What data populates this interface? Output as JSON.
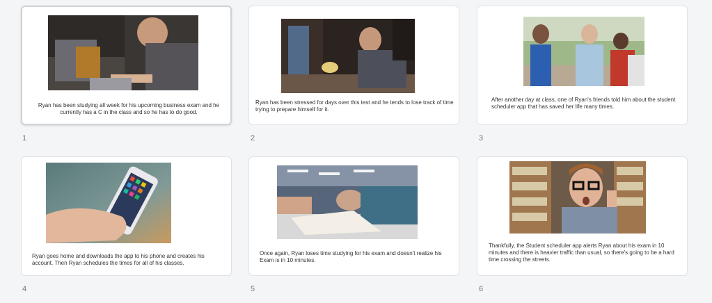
{
  "frames": [
    {
      "number": "1",
      "caption": "Ryan has been studying all week for his upcoming business exam and he currently has a C in the class and so he has to do good."
    },
    {
      "number": "2",
      "caption": "Ryan has been stressed for days over this test and he tends to lose track of time trying to prepare himself for it."
    },
    {
      "number": "3",
      "caption": "After another day at class, one of Ryan's friends told him about the student scheduler app that has saved her life many times."
    },
    {
      "number": "4",
      "caption": "Ryan goes home and downloads the app to his phone and creates his account. Then Ryan schedules the times for all of his classes."
    },
    {
      "number": "5",
      "caption": "Once again, Ryan loses time studying for his exam and doesn't realize his Exam is in 10 minutes."
    },
    {
      "number": "6",
      "caption": "Thankfully, the Student scheduler app alerts Ryan about his exam in 10 minutes and there is heavier traffic than usual, so there's going to be a hard time crossing the streets."
    }
  ]
}
